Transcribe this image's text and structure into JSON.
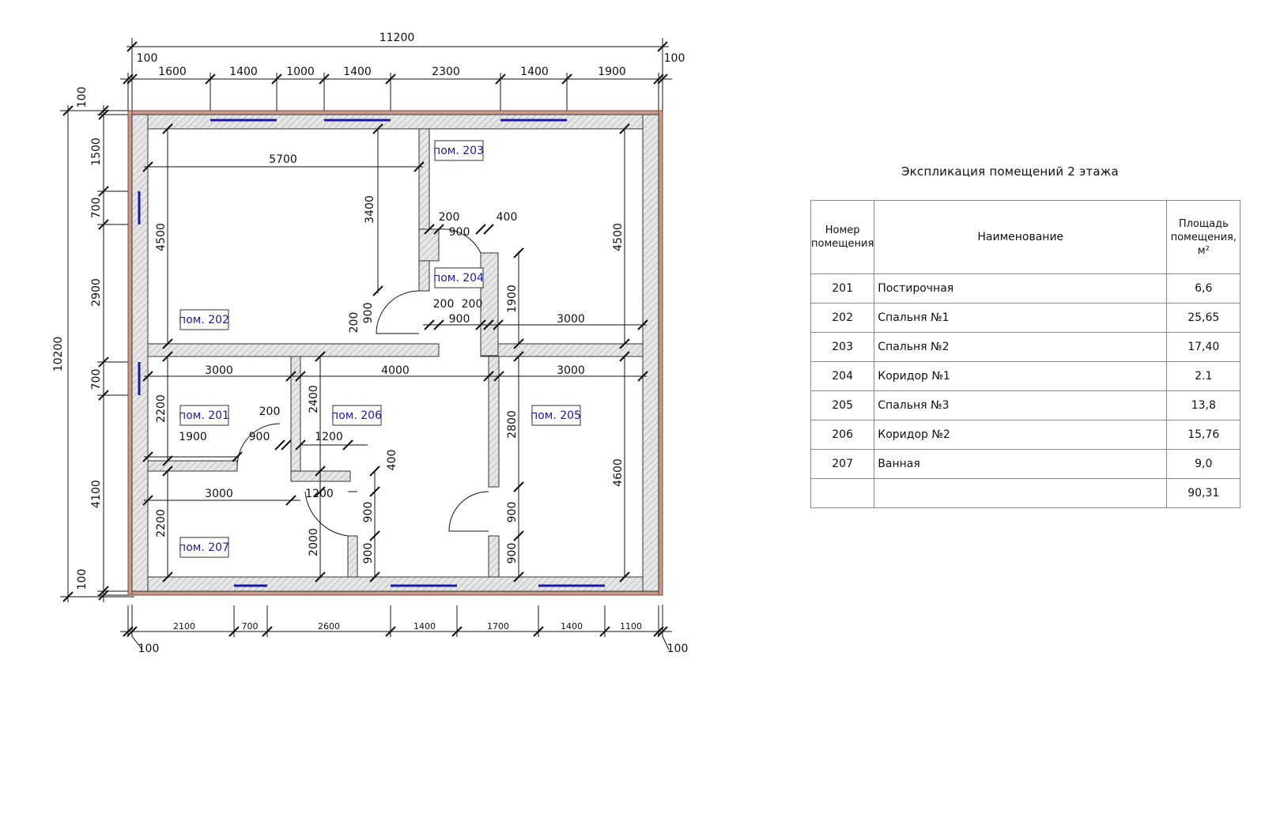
{
  "overall": {
    "width_label": "11200",
    "height_label": "10200"
  },
  "dims_top": [
    "100",
    "1600",
    "1400",
    "1000",
    "1400",
    "2300",
    "1400",
    "1900",
    "100"
  ],
  "dims_bottom": [
    "2100",
    "700",
    "2600",
    "1400",
    "1700",
    "1400",
    "1100"
  ],
  "dims_bottom_offsets": [
    "100",
    "100"
  ],
  "dims_left": [
    "100",
    "1500",
    "700",
    "2900",
    "700",
    "4100",
    "100"
  ],
  "interior_dims": {
    "d5700": "5700",
    "d3400": "3400",
    "d4500a": "4500",
    "d4500b": "4500",
    "d200a": "200",
    "d900a": "900",
    "d400a": "400",
    "d1900a": "1900",
    "d200b": "200",
    "d200c": "200",
    "d900b": "900",
    "d3000a": "3000",
    "d200d": "200",
    "d900c": "900",
    "d3000b": "3000",
    "d4000": "4000",
    "d3000c": "3000",
    "d2200a": "2200",
    "d2400": "2400",
    "d2800": "2800",
    "d4600": "4600",
    "d200e": "200",
    "d1900b": "1900",
    "d900d": "900",
    "d1200a": "1200",
    "d400b": "400",
    "d3000d": "3000",
    "d1200b": "1200",
    "d2200b": "2200",
    "d2000": "2000",
    "d900e": "900",
    "d900f": "900",
    "d900g": "900",
    "d900h": "900"
  },
  "rooms": [
    {
      "id": "201",
      "label": "пом. 201"
    },
    {
      "id": "202",
      "label": "пом. 202"
    },
    {
      "id": "203",
      "label": "пом. 203"
    },
    {
      "id": "204",
      "label": "пом. 204"
    },
    {
      "id": "205",
      "label": "пом. 205"
    },
    {
      "id": "206",
      "label": "пом. 206"
    },
    {
      "id": "207",
      "label": "пом. 207"
    }
  ],
  "explication": {
    "title": "Экспликация помещений 2 этажа",
    "headers": {
      "number": "Номер помещения",
      "name": "Наименование",
      "area": "Площадь помещения, м²"
    },
    "rows": [
      {
        "number": "201",
        "name": "Постирочная",
        "area": "6,6"
      },
      {
        "number": "202",
        "name": "Спальня №1",
        "area": "25,65"
      },
      {
        "number": "203",
        "name": "Спальня №2",
        "area": "17,40"
      },
      {
        "number": "204",
        "name": "Коридор №1",
        "area": "2.1"
      },
      {
        "number": "205",
        "name": "Спальня №3",
        "area": "13,8"
      },
      {
        "number": "206",
        "name": "Коридор №2",
        "area": "15,76"
      },
      {
        "number": "207",
        "name": "Ванная",
        "area": "9,0"
      },
      {
        "number": "",
        "name": "",
        "area": "90,31"
      }
    ]
  },
  "colors": {
    "room_label": "#1a1aa8",
    "window": "#1a1aa8",
    "outer_wall": "#c99a8a"
  }
}
